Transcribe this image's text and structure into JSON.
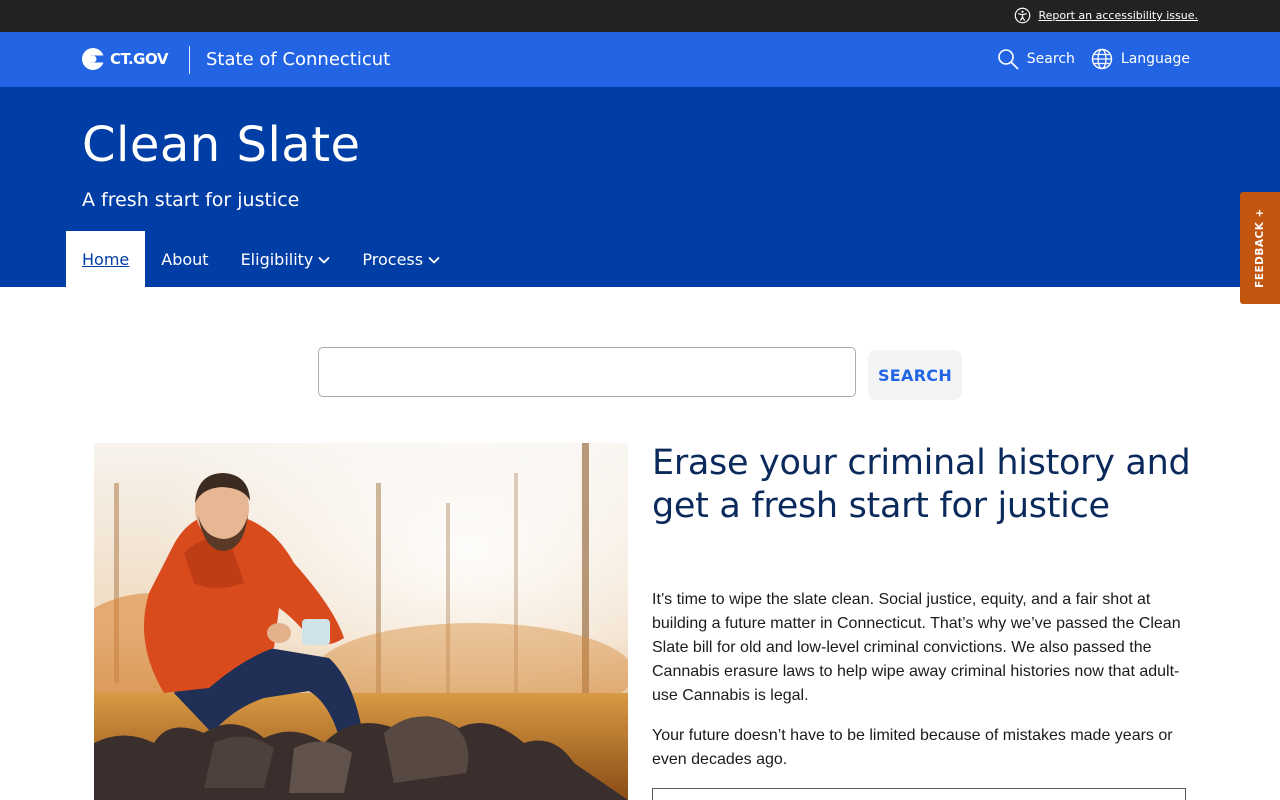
{
  "utility_bar": {
    "accessibility_link": "Report an accessibility issue."
  },
  "gov_bar": {
    "logo_text": "CT.GOV",
    "state_name": "State of Connecticut",
    "search_label": "Search",
    "language_label": "Language"
  },
  "agency": {
    "title": "Clean Slate",
    "subtitle": "A fresh start for justice"
  },
  "nav": {
    "items": [
      {
        "label": "Home",
        "active": true,
        "dropdown": false
      },
      {
        "label": "About",
        "active": false,
        "dropdown": false
      },
      {
        "label": "Eligibility",
        "active": false,
        "dropdown": true
      },
      {
        "label": "Process",
        "active": false,
        "dropdown": true
      }
    ]
  },
  "feedback": {
    "label": "FEEDBACK +"
  },
  "search": {
    "value": "",
    "button_label": "SEARCH"
  },
  "hero": {
    "heading": "Erase your criminal history and get a fresh start for justice",
    "paragraph_1": "It’s time to wipe the slate clean. Social justice, equity, and a fair shot at building a future matter in Connecticut. That’s why we’ve passed the Clean Slate bill for old and low-level criminal convictions. We also passed the Cannabis erasure laws to help wipe away criminal histories now that adult-use Cannabis is legal.",
    "paragraph_2": "Your future doesn’t have to be limited because of mistakes made years or even decades ago."
  },
  "colors": {
    "utility_bar": "#222222",
    "gov_bar": "#2264e4",
    "agency_header": "#003da5",
    "feedback_tab": "#c2560e",
    "heading_text": "#0b2a5c"
  },
  "icons": {
    "accessibility": "accessibility-icon",
    "logo": "ct-logo-icon",
    "search": "search-icon",
    "language": "globe-icon",
    "dropdown": "chevron-down-icon"
  }
}
